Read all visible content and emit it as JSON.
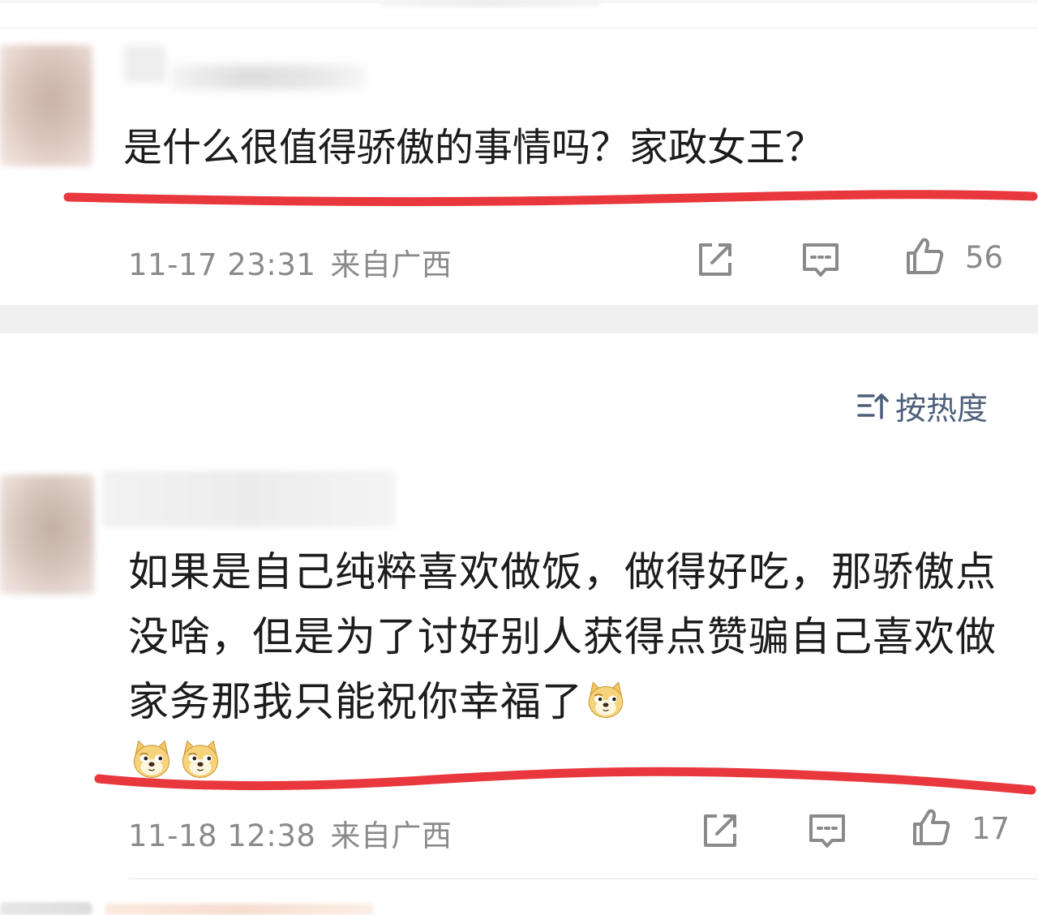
{
  "comments": [
    {
      "text": "是什么很值得骄傲的事情吗？家政女王？",
      "time": "11-17 23:31",
      "location": "来自广西",
      "likes": "56"
    },
    {
      "text": "如果是自己纯粹喜欢做饭，做得好吃，那骄傲点没啥，但是为了讨好别人获得点赞骗自己喜欢做家务那我只能祝你幸福了",
      "time": "11-18 12:38",
      "location": "来自广西",
      "likes": "17",
      "emojis": [
        "doge-emoji",
        "doge-emoji",
        "doge-emoji"
      ]
    }
  ],
  "sort": {
    "label": "按热度"
  },
  "colors": {
    "underline": "#e8383d",
    "meta_text": "#8a8a8a",
    "sort_text": "#4d5f7a",
    "section_band": "#f0f0f0"
  },
  "icons": [
    "share-icon",
    "comment-icon",
    "like-icon",
    "sort-icon",
    "doge-emoji"
  ]
}
